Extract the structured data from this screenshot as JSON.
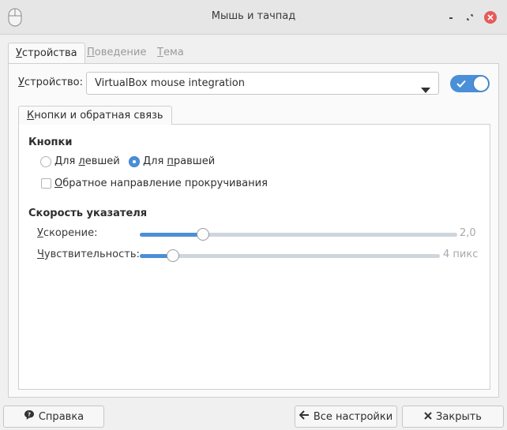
{
  "window": {
    "title": "Мышь и тачпад"
  },
  "tabs": [
    {
      "label_u": "У",
      "label_rest": "стройства"
    },
    {
      "label_u": "П",
      "label_rest": "оведение"
    },
    {
      "label_u": "Т",
      "label_rest": "ема"
    }
  ],
  "device": {
    "label_u": "У",
    "label_rest": "стройство:",
    "selected": "VirtualBox mouse integration",
    "enabled": true
  },
  "inner_tab": {
    "label_u": "К",
    "label_rest": "нопки и обратная связь"
  },
  "buttons_section": {
    "title": "Кнопки",
    "left": {
      "pre": "Для ",
      "u": "л",
      "post": "евшей",
      "checked": false
    },
    "right": {
      "pre": "Для ",
      "u": "п",
      "post": "равшей",
      "checked": true
    },
    "reverse_scroll": {
      "u": "О",
      "post": "братное направление прокручивания",
      "checked": false
    }
  },
  "speed_section": {
    "title": "Скорость указателя",
    "acceleration": {
      "label_u": "У",
      "label_rest": "скорение:",
      "value_text": "2,0",
      "fraction": 0.2
    },
    "sensitivity": {
      "label_u": "Ч",
      "label_rest": "увствительность:",
      "value_text": "4 пикс",
      "fraction": 0.11
    }
  },
  "footer": {
    "help": "Справка",
    "all_settings": "Все настройки",
    "close": "Закрыть"
  },
  "colors": {
    "accent": "#4a8fd8",
    "close": "#e65a5a"
  }
}
